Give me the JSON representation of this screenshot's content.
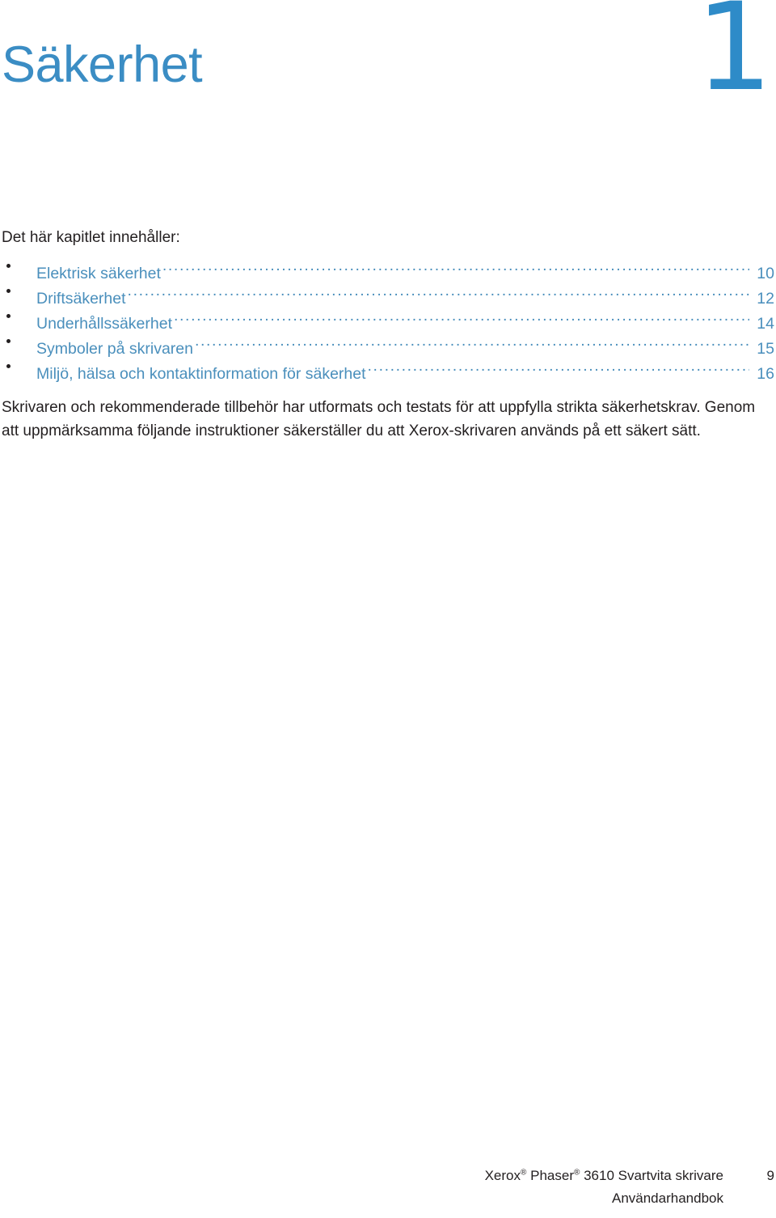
{
  "chapter": {
    "title": "Säkerhet",
    "number": "1"
  },
  "toc": {
    "intro": "Det här kapitlet innehåller:",
    "bullet_glyph": "•",
    "items": [
      {
        "label": "Elektrisk säkerhet",
        "page": "10"
      },
      {
        "label": "Driftsäkerhet",
        "page": "12"
      },
      {
        "label": "Underhållssäkerhet",
        "page": "14"
      },
      {
        "label": "Symboler på skrivaren",
        "page": "15"
      },
      {
        "label": "Miljö, hälsa och kontaktinformation för säkerhet",
        "page": "16"
      }
    ]
  },
  "body": {
    "paragraph": "Skrivaren och rekommenderade tillbehör har utformats och testats för att uppfylla strikta säkerhetskrav. Genom att uppmärksamma följande instruktioner säkerställer du att Xerox-skrivaren används på ett säkert sätt."
  },
  "footer": {
    "product_prefix": "Xerox",
    "product_middle": " Phaser",
    "product_suffix": " 3610 Svartvita skrivare",
    "registered_mark": "®",
    "document_type": "Användarhandbok",
    "page_number": "9"
  },
  "colors": {
    "title_blue": "#3b8dc4",
    "number_blue": "#2e8bc8",
    "toc_blue": "#4a8fbc",
    "body_text": "#231f20",
    "page_background": "#ffffff"
  }
}
